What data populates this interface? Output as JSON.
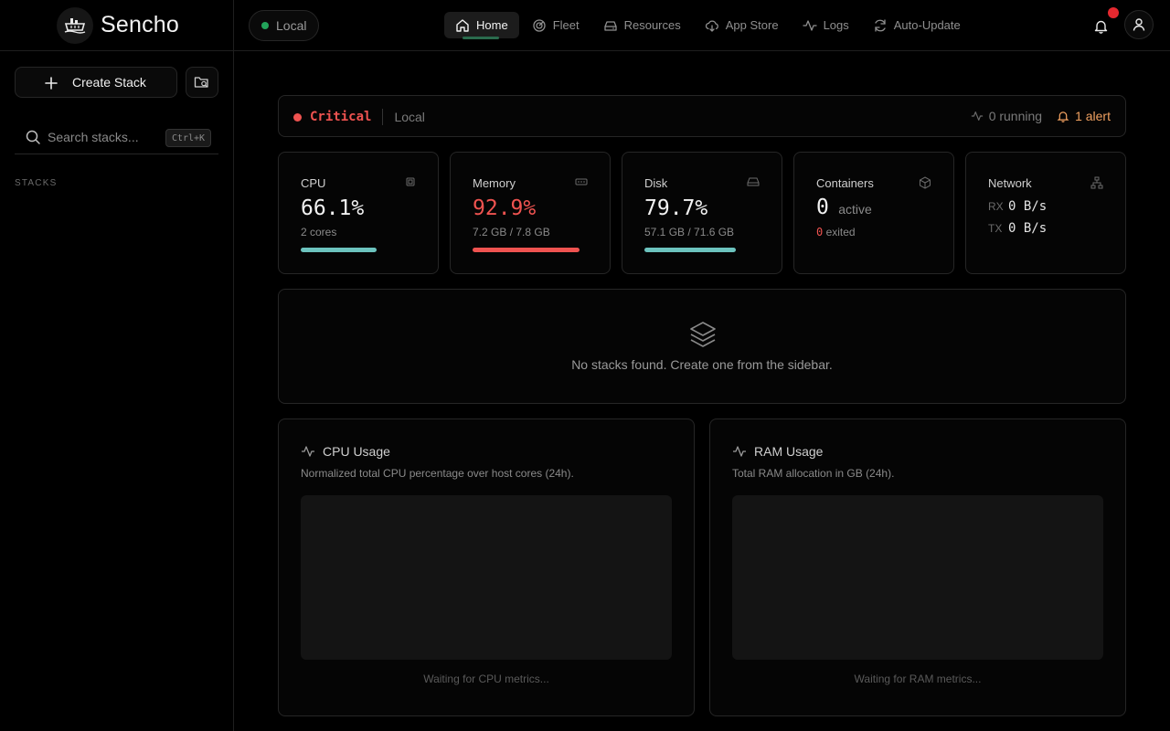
{
  "brand": {
    "name": "Sencho"
  },
  "sidebar": {
    "create_label": "Create Stack",
    "search_placeholder": "Search stacks...",
    "search_shortcut": "Ctrl+K",
    "stacks_heading": "STACKS"
  },
  "topbar": {
    "env_label": "Local",
    "nav": [
      {
        "label": "Home",
        "icon": "home-icon",
        "active": true
      },
      {
        "label": "Fleet",
        "icon": "fleet-icon"
      },
      {
        "label": "Resources",
        "icon": "resources-icon"
      },
      {
        "label": "App Store",
        "icon": "cloud-download-icon"
      },
      {
        "label": "Logs",
        "icon": "activity-icon"
      },
      {
        "label": "Auto-Update",
        "icon": "refresh-icon"
      }
    ]
  },
  "status": {
    "level": "Critical",
    "host": "Local",
    "running": "0 running",
    "alerts": "1 alert",
    "level_color": "#ef5350",
    "alert_color": "#f0a060"
  },
  "cards": {
    "cpu": {
      "title": "CPU",
      "value": "66.1%",
      "sub": "2 cores",
      "percent": 66.1,
      "bar_color": "#6cc3be"
    },
    "memory": {
      "title": "Memory",
      "value": "92.9%",
      "sub": "7.2 GB / 7.8 GB",
      "percent": 92.9,
      "bar_color": "#ef5350",
      "value_color": "#ef5350"
    },
    "disk": {
      "title": "Disk",
      "value": "79.7%",
      "sub": "57.1 GB / 71.6 GB",
      "percent": 79.7,
      "bar_color": "#6cc3be"
    },
    "containers": {
      "title": "Containers",
      "active_count": "0",
      "active_label": "active",
      "exited_count": "0",
      "exited_label": "exited"
    },
    "network": {
      "title": "Network",
      "rx_label": "RX",
      "rx_value": "0 B/s",
      "tx_label": "TX",
      "tx_value": "0 B/s"
    }
  },
  "empty_state": {
    "text": "No stacks found. Create one from the sidebar."
  },
  "charts": {
    "cpu": {
      "title": "CPU Usage",
      "description": "Normalized total CPU percentage over host cores (24h).",
      "waiting": "Waiting for CPU metrics..."
    },
    "ram": {
      "title": "RAM Usage",
      "description": "Total RAM allocation in GB (24h).",
      "waiting": "Waiting for RAM metrics..."
    }
  }
}
